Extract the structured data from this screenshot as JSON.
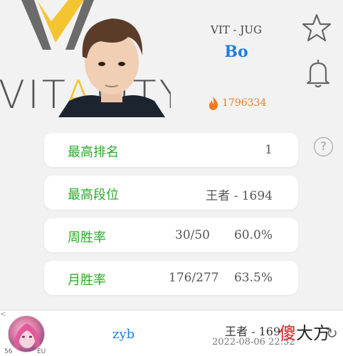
{
  "logo": {
    "word_left": "VIT",
    "word_highlight": "A",
    "word_right": "LITY"
  },
  "player": {
    "team_role": "VIT - JUG",
    "name": "Bo",
    "heat_value": "1796334"
  },
  "help": {
    "label": "?"
  },
  "stats": [
    {
      "label": "最高排名",
      "value": "1"
    },
    {
      "label": "最高段位",
      "value": "王者 - 1694"
    },
    {
      "label": "周胜率",
      "record": "30/50",
      "rate": "60.0%"
    },
    {
      "label": "月胜率",
      "record": "176/277",
      "rate": "63.5%"
    }
  ],
  "bottom_bar": {
    "left_edge": "<",
    "level": "56",
    "region": "EU",
    "name": "zyb",
    "rank": "王者 - 169",
    "time": "2022-08-06 22:32",
    "refresh": "↻"
  },
  "watermark": {
    "red": "傻",
    "rest": "大方"
  },
  "colors": {
    "accent_blue": "#1f7ee0",
    "label_green": "#2eaa2e",
    "heat_orange": "#f07c22",
    "logo_yellow": "#f4c531"
  },
  "icons": [
    "star-outline-icon",
    "bell-icon",
    "flame-icon",
    "help-icon",
    "refresh-icon"
  ]
}
